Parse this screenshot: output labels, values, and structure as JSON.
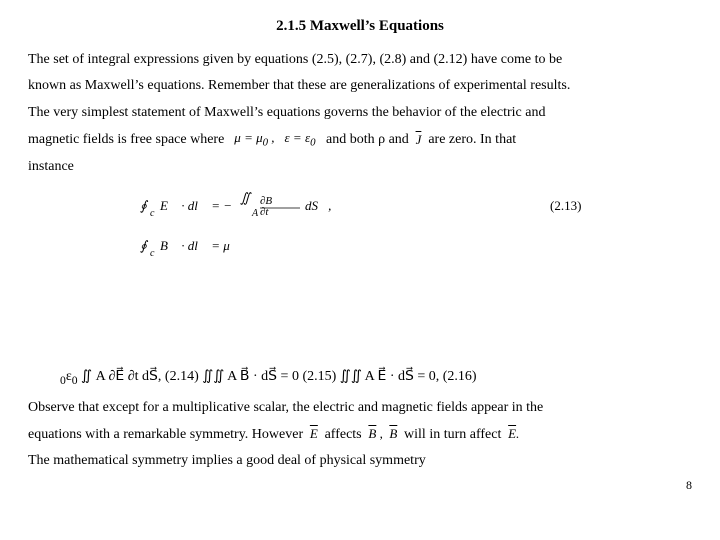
{
  "title": "2.1.5 Maxwell’s Equations",
  "paragraphs": {
    "p1": "The set of integral expressions given by equations (2.5), (2.7), (2.8) and (2.12) have come to be",
    "p2": "known as Maxwell’s equations. Remember that these are generalizations of experimental results.",
    "p3": "The very simplest statement of Maxwell’s equations governs the behavior of the electric and",
    "p4_pre": "magnetic fields is free space where",
    "p4_mid": "and both ρ and",
    "p4_post": "are zero. In that",
    "p5": "instance",
    "p6": "Observe that except for a multiplicative scalar, the electric and magnetic fields appear in the",
    "p7_pre": "equations with a remarkable symmetry.  However",
    "p7_mid": "affects",
    "p7_post": "will in turn affect",
    "p8": "The mathematical symmetry implies a good deal of physical symmetry"
  },
  "equations": [
    {
      "label": "(2.13)"
    },
    {
      "label": "(2.14)"
    },
    {
      "label": "(2.15)"
    },
    {
      "label": "(2.16)"
    }
  ],
  "page_number": "8"
}
